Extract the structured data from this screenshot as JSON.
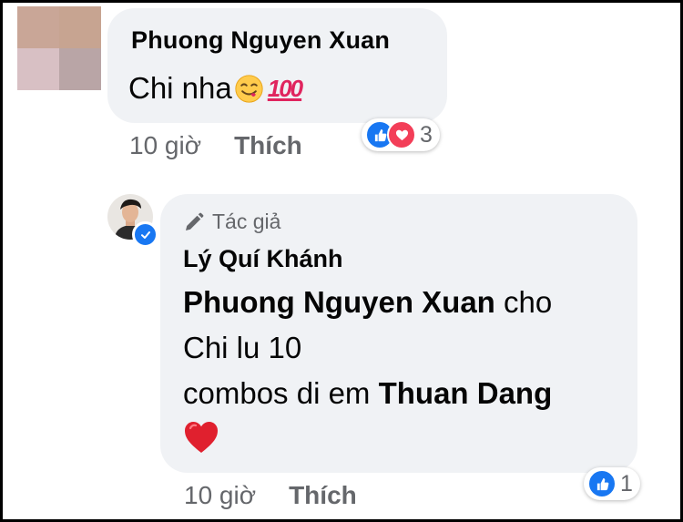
{
  "comment": {
    "author": "Phuong Nguyen Xuan",
    "text": "Chi nha",
    "emoji": [
      "smiling-face-with-tongue",
      "hundred-points"
    ],
    "hundred_glyph": "100",
    "time": "10 giờ",
    "like_label": "Thích",
    "reactions": {
      "types": [
        "like",
        "love"
      ],
      "count": "3"
    }
  },
  "reply": {
    "author_badge": "Tác giả",
    "author": "Lý Quí Khánh",
    "mention_1": "Phuong Nguyen Xuan",
    "text_after_mention": " cho",
    "line_2": "Chi lu 10",
    "line_3_prefix": "combos di em ",
    "mention_2": "Thuan Dang",
    "emoji": "red-heart",
    "time": "10 giờ",
    "like_label": "Thích",
    "reactions": {
      "types": [
        "like"
      ],
      "count": "1"
    },
    "verified": true
  },
  "colors": {
    "bubble": "#f0f2f5",
    "text": "#050505",
    "meta": "#65676b",
    "like_blue": "#1877f2",
    "love_red": "#f33e58"
  }
}
